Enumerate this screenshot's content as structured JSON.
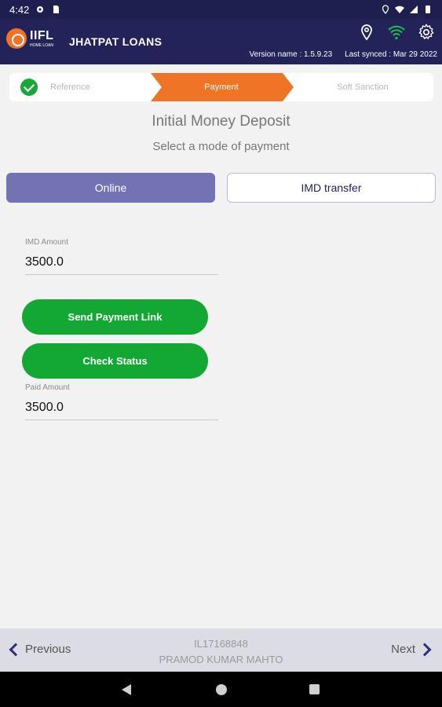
{
  "status_bar": {
    "time": "4:42"
  },
  "header": {
    "logo_brand": "IIFL",
    "logo_sub": "HOME LOAN",
    "app_title": "JHATPAT LOANS",
    "version": "Version name : 1.5.9.23",
    "last_synced": "Last synced : Mar 29 2022",
    "icons": [
      "location-icon",
      "wifi-icon",
      "gear-icon"
    ]
  },
  "stepper": {
    "steps": [
      {
        "label": "Reference",
        "state": "completed"
      },
      {
        "label": "Payment",
        "state": "active"
      },
      {
        "label": "Soft Sanction",
        "state": "pending"
      }
    ]
  },
  "main": {
    "title": "Initial Money Deposit",
    "subtitle": "Select a mode of payment",
    "modes": [
      {
        "label": "Online",
        "selected": true
      },
      {
        "label": "IMD transfer",
        "selected": false
      }
    ],
    "imd_amount_label": "IMD Amount",
    "imd_amount_value": "3500.0",
    "send_link_label": "Send Payment Link",
    "check_status_label": "Check Status",
    "paid_amount_label": "Paid Amount",
    "paid_amount_value": "3500.0"
  },
  "bottom_nav": {
    "previous_label": "Previous",
    "next_label": "Next",
    "application_id": "IL17168848",
    "customer_name": "PRAMOD KUMAR MAHTO"
  },
  "colors": {
    "header_bg": "#23235a",
    "accent_orange": "#f07426",
    "online_selected": "#7272b4",
    "green_button": "#12a833",
    "completed_check": "#19a63a"
  }
}
